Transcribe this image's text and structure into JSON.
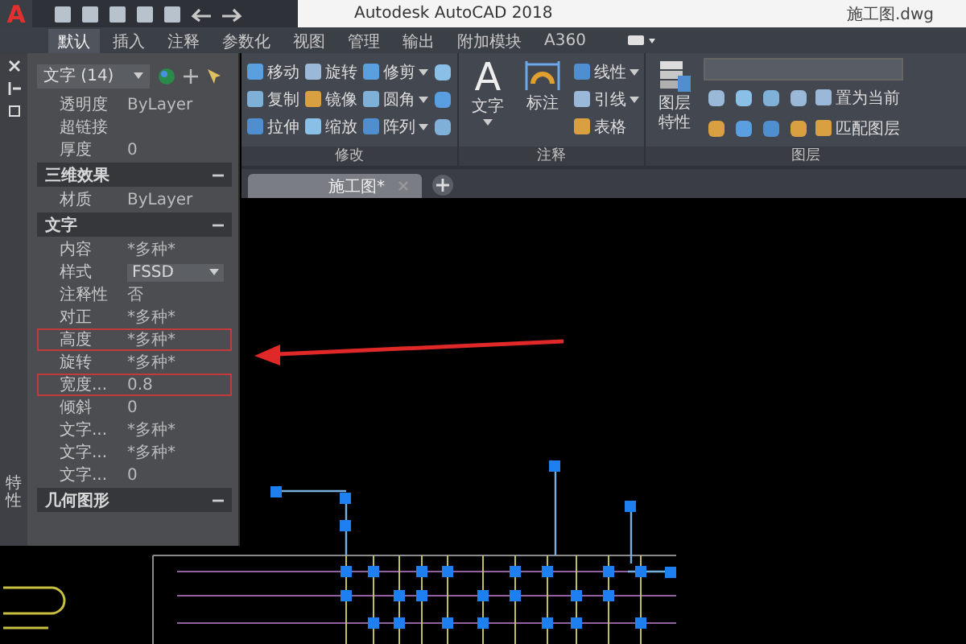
{
  "title_bar": {
    "logo": "A",
    "app_title": "Autodesk AutoCAD 2018",
    "file_name": "施工图.dwg"
  },
  "ribbon_tabs": [
    {
      "label": "默认",
      "selected": true
    },
    {
      "label": "插入",
      "selected": false
    },
    {
      "label": "注释",
      "selected": false
    },
    {
      "label": "参数化",
      "selected": false
    },
    {
      "label": "视图",
      "selected": false
    },
    {
      "label": "管理",
      "selected": false
    },
    {
      "label": "输出",
      "selected": false
    },
    {
      "label": "附加模块",
      "selected": false
    },
    {
      "label": "A360",
      "selected": false
    }
  ],
  "ribbon_panels": [
    {
      "title": "修改",
      "kind": "tools",
      "tools": [
        {
          "kind": "small",
          "label": "移动",
          "has_menu": false
        },
        {
          "kind": "small",
          "label": "复制",
          "has_menu": false
        },
        {
          "kind": "small",
          "label": "拉伸",
          "has_menu": false
        },
        {
          "kind": "small",
          "label": "旋转",
          "has_menu": false
        },
        {
          "kind": "small",
          "label": "镜像",
          "has_menu": false
        },
        {
          "kind": "small",
          "label": "缩放",
          "has_menu": false
        },
        {
          "kind": "small",
          "label": "修剪",
          "has_menu": true
        },
        {
          "kind": "small",
          "label": "圆角",
          "has_menu": true
        },
        {
          "kind": "small",
          "label": "阵列",
          "has_menu": true
        },
        {
          "kind": "icon"
        },
        {
          "kind": "icon"
        },
        {
          "kind": "icon"
        }
      ]
    },
    {
      "title": "注释",
      "kind": "tools",
      "tools": [
        {
          "kind": "large",
          "glyph": "A",
          "label": "文字",
          "has_menu": true
        },
        {
          "kind": "large",
          "label": "标注",
          "has_menu": false
        },
        {
          "kind": "small",
          "label": "线性",
          "has_menu": true
        },
        {
          "kind": "small",
          "label": "引线",
          "has_menu": true
        },
        {
          "kind": "small",
          "label": "表格",
          "has_menu": false
        }
      ]
    },
    {
      "title": "图层",
      "kind": "layers",
      "tools": [
        {
          "kind": "large",
          "label": "图层特性",
          "has_menu": false
        },
        {
          "kind": "icon"
        },
        {
          "kind": "icon"
        },
        {
          "kind": "icon"
        },
        {
          "kind": "icon"
        },
        {
          "kind": "icon"
        },
        {
          "kind": "icon"
        },
        {
          "kind": "icon"
        },
        {
          "kind": "icon"
        },
        {
          "kind": "small",
          "label": "置为当前",
          "has_menu": false
        },
        {
          "kind": "small",
          "label": "匹配图层",
          "has_menu": false
        }
      ]
    }
  ],
  "document_tabs": [
    {
      "label": "施工图*",
      "selected": true
    }
  ],
  "palette": {
    "side_label": "特性",
    "selector": "文字 (14)",
    "groups": [
      {
        "rows": [
          {
            "name": "透明度",
            "value": "ByLayer",
            "kind": "text",
            "highlighted": false
          },
          {
            "name": "超链接",
            "kind": "text",
            "highlighted": false
          },
          {
            "name": "厚度",
            "value": "0",
            "kind": "text",
            "highlighted": false
          }
        ]
      },
      {
        "title": "三维效果",
        "rows": [
          {
            "name": "材质",
            "value": "ByLayer",
            "kind": "text",
            "highlighted": false
          }
        ]
      },
      {
        "title": "文字",
        "rows": [
          {
            "name": "内容",
            "value": "*多种*",
            "kind": "text",
            "highlighted": false
          },
          {
            "name": "样式",
            "value": "FSSD",
            "kind": "dropdown",
            "highlighted": false
          },
          {
            "name": "注释性",
            "value": "否",
            "kind": "text",
            "highlighted": false
          },
          {
            "name": "对正",
            "value": "*多种*",
            "kind": "text",
            "highlighted": false
          },
          {
            "name": "高度",
            "value": "*多种*",
            "kind": "text",
            "highlighted": true
          },
          {
            "name": "旋转",
            "value": "*多种*",
            "kind": "text",
            "highlighted": false
          },
          {
            "name": "宽度...",
            "value": "0.8",
            "kind": "text",
            "highlighted": true
          },
          {
            "name": "倾斜",
            "value": "0",
            "kind": "text",
            "highlighted": false
          },
          {
            "name": "文字...",
            "value": "*多种*",
            "kind": "text",
            "highlighted": false
          },
          {
            "name": "文字...",
            "value": "*多种*",
            "kind": "text",
            "highlighted": false
          },
          {
            "name": "文字...",
            "value": "0",
            "kind": "text",
            "highlighted": false
          }
        ]
      },
      {
        "title": "几何图形"
      }
    ]
  }
}
